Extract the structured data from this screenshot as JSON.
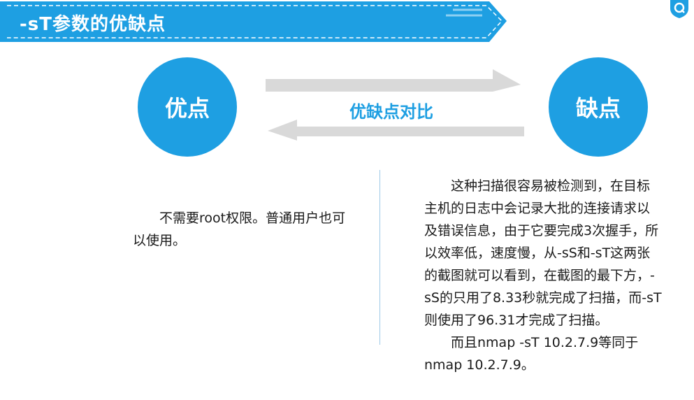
{
  "header": {
    "title": "-sT参数的优缺点"
  },
  "pros": {
    "label": "优点",
    "text": "不需要root权限。普通用户也可以使用。"
  },
  "cons": {
    "label": "缺点",
    "text": "这种扫描很容易被检测到，在目标主机的日志中会记录大批的连接请求以及错误信息，由于它要完成3次握手，所以效率低，速度慢，从-sS和-sT这两张的截图就可以看到，在截图的最下方，-sS的只用了8.33秒就完成了扫描，而-sT则使用了96.31才完成了扫描。",
    "text2": "而且nmap -sT 10.2.7.9等同于nmap 10.2.7.9。"
  },
  "compare": {
    "label": "优缺点对比"
  },
  "colors": {
    "accent": "#1e9fe2",
    "arrow": "#d9d9d9"
  },
  "icons": {
    "logo": "shield-logo-icon"
  }
}
